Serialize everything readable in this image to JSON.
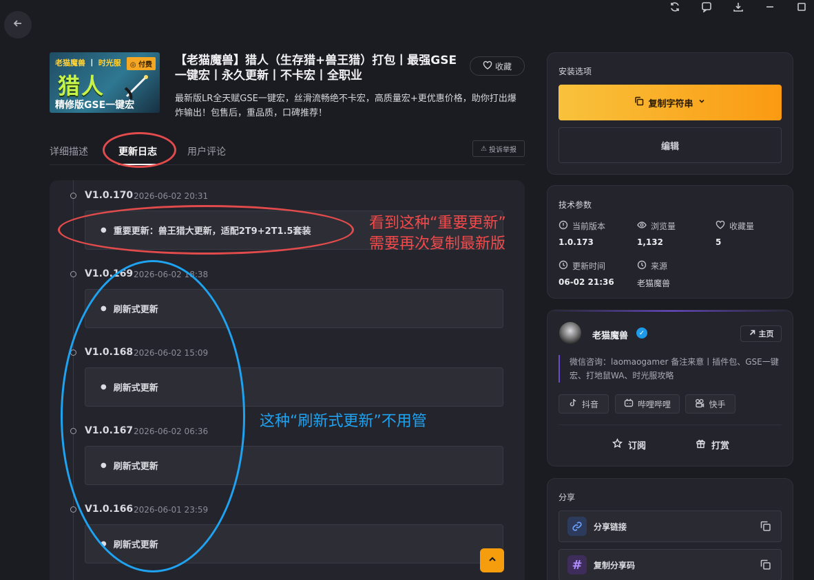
{
  "icons": {
    "top": [
      "refresh-icon",
      "comment-icon",
      "download-icon",
      "minimize-icon",
      "maximize-icon"
    ],
    "back": "arrow-left-icon"
  },
  "cover": {
    "top_left": "老猫魔兽",
    "top_separator": "丨",
    "top_right": "时光服",
    "badge": "付费",
    "big": "猎人",
    "sub": "精修版GSE一键宏"
  },
  "header": {
    "title": "【老猫魔兽】猎人（生存猎+兽王猎）打包丨最强GSE一键宏丨永久更新丨不卡宏丨全职业",
    "description": "最新版LR全天赋GSE一键宏，丝滑流畅绝不卡宏，高质量宏+更优惠价格，助你打出爆炸输出！包售后，重品质，口碑推荐！",
    "favorite_label": "收藏"
  },
  "tabs": [
    {
      "label": "详细描述"
    },
    {
      "label": "更新日志"
    },
    {
      "label": "用户评论"
    }
  ],
  "report_label": "投诉举报",
  "changelog": [
    {
      "version": "V1.0.170",
      "date": "2026-06-02 20:31",
      "note": "重要更新：兽王猎大更新，适配2T9+2T1.5套装"
    },
    {
      "version": "V1.0.169",
      "date": "2026-06-02 18:38",
      "note": "刷新式更新"
    },
    {
      "version": "V1.0.168",
      "date": "2026-06-02 15:09",
      "note": "刷新式更新"
    },
    {
      "version": "V1.0.167",
      "date": "2026-06-02 06:36",
      "note": "刷新式更新"
    },
    {
      "version": "V1.0.166",
      "date": "2026-06-01 23:59",
      "note": "刷新式更新"
    }
  ],
  "install": {
    "title": "安装选项",
    "copy_label": "复制字符串",
    "edit_label": "编辑"
  },
  "tech": {
    "title": "技术参数",
    "params": [
      {
        "label": "当前版本",
        "value": "1.0.173",
        "icon": "info-circle-icon"
      },
      {
        "label": "浏览量",
        "value": "1,132",
        "icon": "eye-icon"
      },
      {
        "label": "收藏量",
        "value": "5",
        "icon": "heart-icon"
      },
      {
        "label": "更新时间",
        "value": "06-02 21:36",
        "icon": "clock-icon"
      },
      {
        "label": "来源",
        "value": "老猫魔兽",
        "icon": "clock-icon"
      }
    ]
  },
  "author": {
    "name": "老猫魔兽",
    "home_label": "主页",
    "bio": "微信咨询：laomaogamer 备注来意丨插件包、GSE一键宏、打地鼠WA、时光服攻略",
    "socials": [
      {
        "label": "抖音",
        "icon": "tiktok-icon"
      },
      {
        "label": "哔哩哔哩",
        "icon": "bilibili-icon"
      },
      {
        "label": "快手",
        "icon": "kuaishou-icon"
      }
    ],
    "subscribe_label": "订阅",
    "tip_label": "打赏"
  },
  "share": {
    "title": "分享",
    "link_label": "分享链接",
    "code_label": "复制分享码"
  },
  "annotations": {
    "red_text": "看到这种“重要更新”\n需要再次复制最新版",
    "blue_text": "这种“刷新式更新”不用管"
  },
  "colors": {
    "accent_orange": "#f9a825",
    "annotation_red": "#e14b4b",
    "annotation_blue": "#1fa3f0",
    "author_purple": "#6b4ad0"
  }
}
